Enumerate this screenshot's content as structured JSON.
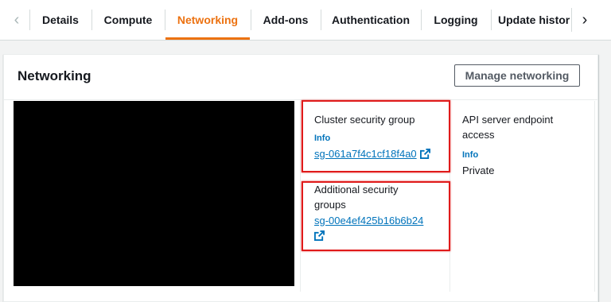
{
  "tabs": {
    "items": [
      {
        "label": "Details",
        "active": false
      },
      {
        "label": "Compute",
        "active": false
      },
      {
        "label": "Networking",
        "active": true
      },
      {
        "label": "Add-ons",
        "active": false
      },
      {
        "label": "Authentication",
        "active": false
      },
      {
        "label": "Logging",
        "active": false
      },
      {
        "label": "Update histor",
        "active": false
      }
    ],
    "prev_icon": "chevron-left-icon",
    "next_icon": "chevron-right-icon"
  },
  "panel": {
    "title": "Networking",
    "manage_button": "Manage networking"
  },
  "cluster_sg": {
    "label": "Cluster security group",
    "info": "Info",
    "value": "sg-061a7f4c1cf18f4a0",
    "icon": "external-link-icon"
  },
  "additional_sg": {
    "label_line1": "Additional security",
    "label_line2": "groups",
    "value": "sg-00e4ef425b16b6b24",
    "icon": "external-link-icon"
  },
  "api_endpoint": {
    "label_line1": "API server endpoint",
    "label_line2": "access",
    "info": "Info",
    "value": "Private"
  },
  "colors": {
    "accent": "#ec7211",
    "link": "#0073bb",
    "annotation": "#e01b1b"
  }
}
